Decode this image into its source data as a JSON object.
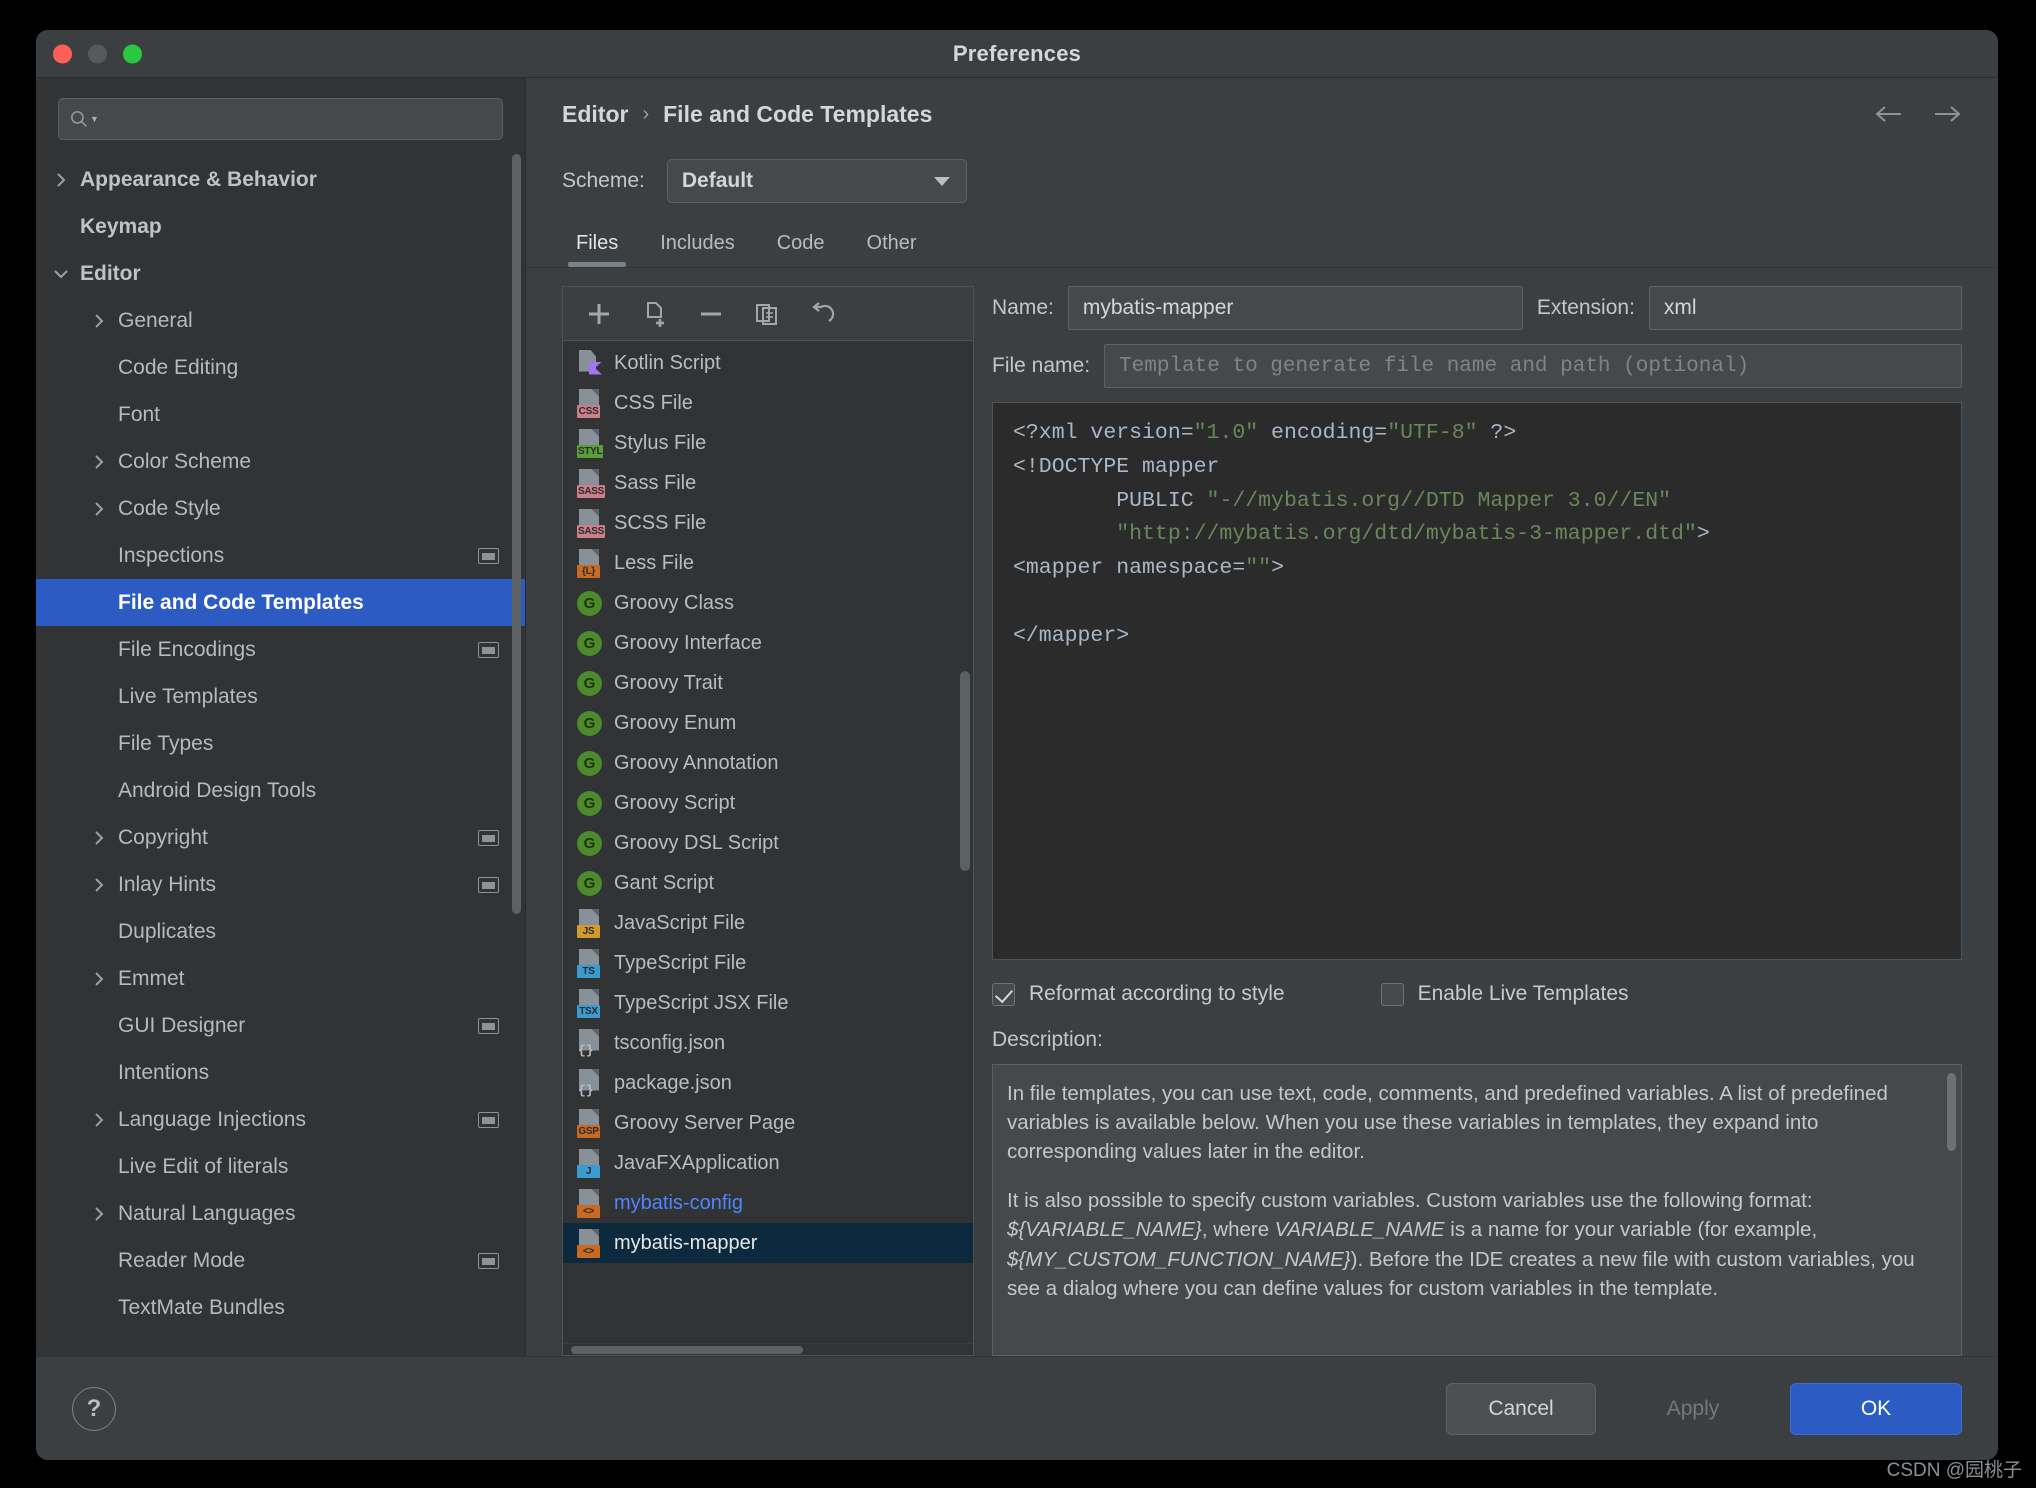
{
  "window": {
    "title": "Preferences",
    "traffic_lights": [
      "close",
      "minimize",
      "maximize"
    ]
  },
  "sidebar": {
    "search": {
      "value": "",
      "placeholder": ""
    },
    "items": [
      {
        "label": "Appearance & Behavior",
        "level": 1,
        "arrow": "right",
        "bold": true,
        "badge": false,
        "selected": false
      },
      {
        "label": "Keymap",
        "level": 1,
        "arrow": "none",
        "bold": true,
        "badge": false,
        "selected": false
      },
      {
        "label": "Editor",
        "level": 1,
        "arrow": "down",
        "bold": true,
        "badge": false,
        "selected": false
      },
      {
        "label": "General",
        "level": 2,
        "arrow": "right",
        "bold": false,
        "badge": false,
        "selected": false
      },
      {
        "label": "Code Editing",
        "level": 2,
        "arrow": "none",
        "bold": false,
        "badge": false,
        "selected": false
      },
      {
        "label": "Font",
        "level": 2,
        "arrow": "none",
        "bold": false,
        "badge": false,
        "selected": false
      },
      {
        "label": "Color Scheme",
        "level": 2,
        "arrow": "right",
        "bold": false,
        "badge": false,
        "selected": false
      },
      {
        "label": "Code Style",
        "level": 2,
        "arrow": "right",
        "bold": false,
        "badge": false,
        "selected": false
      },
      {
        "label": "Inspections",
        "level": 2,
        "arrow": "none",
        "bold": false,
        "badge": true,
        "selected": false
      },
      {
        "label": "File and Code Templates",
        "level": 2,
        "arrow": "none",
        "bold": true,
        "badge": false,
        "selected": true
      },
      {
        "label": "File Encodings",
        "level": 2,
        "arrow": "none",
        "bold": false,
        "badge": true,
        "selected": false
      },
      {
        "label": "Live Templates",
        "level": 2,
        "arrow": "none",
        "bold": false,
        "badge": false,
        "selected": false
      },
      {
        "label": "File Types",
        "level": 2,
        "arrow": "none",
        "bold": false,
        "badge": false,
        "selected": false
      },
      {
        "label": "Android Design Tools",
        "level": 2,
        "arrow": "none",
        "bold": false,
        "badge": false,
        "selected": false
      },
      {
        "label": "Copyright",
        "level": 2,
        "arrow": "right",
        "bold": false,
        "badge": true,
        "selected": false
      },
      {
        "label": "Inlay Hints",
        "level": 2,
        "arrow": "right",
        "bold": false,
        "badge": true,
        "selected": false
      },
      {
        "label": "Duplicates",
        "level": 2,
        "arrow": "none",
        "bold": false,
        "badge": false,
        "selected": false
      },
      {
        "label": "Emmet",
        "level": 2,
        "arrow": "right",
        "bold": false,
        "badge": false,
        "selected": false
      },
      {
        "label": "GUI Designer",
        "level": 2,
        "arrow": "none",
        "bold": false,
        "badge": true,
        "selected": false
      },
      {
        "label": "Intentions",
        "level": 2,
        "arrow": "none",
        "bold": false,
        "badge": false,
        "selected": false
      },
      {
        "label": "Language Injections",
        "level": 2,
        "arrow": "right",
        "bold": false,
        "badge": true,
        "selected": false
      },
      {
        "label": "Live Edit of literals",
        "level": 2,
        "arrow": "none",
        "bold": false,
        "badge": false,
        "selected": false
      },
      {
        "label": "Natural Languages",
        "level": 2,
        "arrow": "right",
        "bold": false,
        "badge": false,
        "selected": false
      },
      {
        "label": "Reader Mode",
        "level": 2,
        "arrow": "none",
        "bold": false,
        "badge": true,
        "selected": false
      },
      {
        "label": "TextMate Bundles",
        "level": 2,
        "arrow": "none",
        "bold": false,
        "badge": false,
        "selected": false
      }
    ]
  },
  "breadcrumb": {
    "parent": "Editor",
    "separator": "›",
    "current": "File and Code Templates"
  },
  "scheme": {
    "label": "Scheme:",
    "value": "Default"
  },
  "tabs": [
    {
      "label": "Files",
      "active": true
    },
    {
      "label": "Includes",
      "active": false
    },
    {
      "label": "Code",
      "active": false
    },
    {
      "label": "Other",
      "active": false
    }
  ],
  "list_toolbar": [
    {
      "name": "add-template-button",
      "glyph": "plus"
    },
    {
      "name": "copy-template-button",
      "glyph": "file-plus"
    },
    {
      "name": "remove-template-button",
      "glyph": "minus"
    },
    {
      "name": "duplicate-template-button",
      "glyph": "copy"
    },
    {
      "name": "reset-template-button",
      "glyph": "undo"
    }
  ],
  "templates": [
    {
      "label": "Kotlin Script",
      "icon": "kotlin",
      "badge": "",
      "badge_bg": "#a475f0",
      "selected": false,
      "highlight": false
    },
    {
      "label": "CSS File",
      "icon": "file",
      "badge": "CSS",
      "badge_bg": "#cc7f89",
      "selected": false,
      "highlight": false
    },
    {
      "label": "Stylus File",
      "icon": "file",
      "badge": "STYL",
      "badge_bg": "#5a9e3a",
      "selected": false,
      "highlight": false
    },
    {
      "label": "Sass File",
      "icon": "file",
      "badge": "SASS",
      "badge_bg": "#cc7f89",
      "selected": false,
      "highlight": false
    },
    {
      "label": "SCSS File",
      "icon": "file",
      "badge": "SASS",
      "badge_bg": "#cc7f89",
      "selected": false,
      "highlight": false
    },
    {
      "label": "Less File",
      "icon": "file",
      "badge": "{L}",
      "badge_bg": "#c96a23",
      "selected": false,
      "highlight": false
    },
    {
      "label": "Groovy Class",
      "icon": "groovy",
      "badge": "G",
      "badge_bg": "#4c8a2b",
      "selected": false,
      "highlight": false
    },
    {
      "label": "Groovy Interface",
      "icon": "groovy",
      "badge": "G",
      "badge_bg": "#4c8a2b",
      "selected": false,
      "highlight": false
    },
    {
      "label": "Groovy Trait",
      "icon": "groovy",
      "badge": "G",
      "badge_bg": "#4c8a2b",
      "selected": false,
      "highlight": false
    },
    {
      "label": "Groovy Enum",
      "icon": "groovy",
      "badge": "G",
      "badge_bg": "#4c8a2b",
      "selected": false,
      "highlight": false
    },
    {
      "label": "Groovy Annotation",
      "icon": "groovy",
      "badge": "G",
      "badge_bg": "#4c8a2b",
      "selected": false,
      "highlight": false
    },
    {
      "label": "Groovy Script",
      "icon": "groovy",
      "badge": "G",
      "badge_bg": "#4c8a2b",
      "selected": false,
      "highlight": false
    },
    {
      "label": "Groovy DSL Script",
      "icon": "groovy",
      "badge": "G",
      "badge_bg": "#4c8a2b",
      "selected": false,
      "highlight": false
    },
    {
      "label": "Gant Script",
      "icon": "groovy",
      "badge": "G",
      "badge_bg": "#4c8a2b",
      "selected": false,
      "highlight": false
    },
    {
      "label": "JavaScript File",
      "icon": "file",
      "badge": "JS",
      "badge_bg": "#d09c2e",
      "selected": false,
      "highlight": false
    },
    {
      "label": "TypeScript File",
      "icon": "file",
      "badge": "TS",
      "badge_bg": "#3a9bd1",
      "selected": false,
      "highlight": false
    },
    {
      "label": "TypeScript JSX File",
      "icon": "file",
      "badge": "TSX",
      "badge_bg": "#3a9bd1",
      "selected": false,
      "highlight": false
    },
    {
      "label": "tsconfig.json",
      "icon": "json",
      "badge": "{}",
      "badge_bg": "",
      "selected": false,
      "highlight": false
    },
    {
      "label": "package.json",
      "icon": "json",
      "badge": "{}",
      "badge_bg": "",
      "selected": false,
      "highlight": false
    },
    {
      "label": "Groovy Server Page",
      "icon": "file",
      "badge": "GSP",
      "badge_bg": "#c96a23",
      "selected": false,
      "highlight": false
    },
    {
      "label": "JavaFXApplication",
      "icon": "file",
      "badge": "J",
      "badge_bg": "#3a9bd1",
      "selected": false,
      "highlight": false
    },
    {
      "label": "mybatis-config",
      "icon": "file",
      "badge": "<>",
      "badge_bg": "#c96a23",
      "selected": false,
      "highlight": true
    },
    {
      "label": "mybatis-mapper",
      "icon": "file",
      "badge": "<>",
      "badge_bg": "#c96a23",
      "selected": true,
      "highlight": false
    }
  ],
  "form": {
    "name_label": "Name:",
    "name_value": "mybatis-mapper",
    "extension_label": "Extension:",
    "extension_value": "xml",
    "filename_label": "File name:",
    "filename_value": "",
    "filename_placeholder": "Template to generate file name and path (optional)"
  },
  "code": {
    "lines": [
      [
        {
          "t": "<?xml version=",
          "c": "tag"
        },
        {
          "t": "\"1.0\"",
          "c": "str"
        },
        {
          "t": " encoding=",
          "c": "tag"
        },
        {
          "t": "\"UTF-8\"",
          "c": "str"
        },
        {
          "t": " ?>",
          "c": "tag"
        }
      ],
      [
        {
          "t": "<!DOCTYPE mapper",
          "c": "tag"
        }
      ],
      [
        {
          "t": "        PUBLIC ",
          "c": "tag"
        },
        {
          "t": "\"-//mybatis.org//DTD Mapper 3.0//EN\"",
          "c": "str"
        }
      ],
      [
        {
          "t": "        ",
          "c": "tag"
        },
        {
          "t": "\"http://mybatis.org/dtd/mybatis-3-mapper.dtd\"",
          "c": "str"
        },
        {
          "t": ">",
          "c": "tag"
        }
      ],
      [
        {
          "t": "<mapper namespace=",
          "c": "tag"
        },
        {
          "t": "\"\"",
          "c": "str"
        },
        {
          "t": ">",
          "c": "tag"
        }
      ],
      [
        {
          "t": "",
          "c": "tag"
        }
      ],
      [
        {
          "t": "</mapper>",
          "c": "tag"
        }
      ]
    ]
  },
  "checkboxes": [
    {
      "label": "Reformat according to style",
      "checked": true
    },
    {
      "label": "Enable Live Templates",
      "checked": false
    }
  ],
  "description": {
    "label": "Description:",
    "paragraphs": [
      [
        {
          "t": "In file templates, you can use text, code, comments, and predefined variables. A list of predefined variables is available below. When you use these variables in templates, they expand into corresponding values later in the editor.",
          "i": false
        }
      ],
      [
        {
          "t": "It is also possible to specify custom variables. Custom variables use the following format: ",
          "i": false
        },
        {
          "t": "${VARIABLE_NAME}",
          "i": true
        },
        {
          "t": ", where ",
          "i": false
        },
        {
          "t": "VARIABLE_NAME",
          "i": true
        },
        {
          "t": " is a name for your variable (for example, ",
          "i": false
        },
        {
          "t": "${MY_CUSTOM_FUNCTION_NAME}",
          "i": true
        },
        {
          "t": "). Before the IDE creates a new file with custom variables, you see a dialog where you can define values for custom variables in the template.",
          "i": false
        }
      ]
    ]
  },
  "footer": {
    "help": "?",
    "cancel": "Cancel",
    "apply": "Apply",
    "ok": "OK"
  },
  "watermark": "CSDN @园桃子",
  "colors": {
    "accent_blue": "#2d5bc4",
    "selected_row": "#0d293e",
    "link_blue": "#4d86ff",
    "string_green": "#6a8759",
    "code_fg": "#a9b7c6"
  }
}
